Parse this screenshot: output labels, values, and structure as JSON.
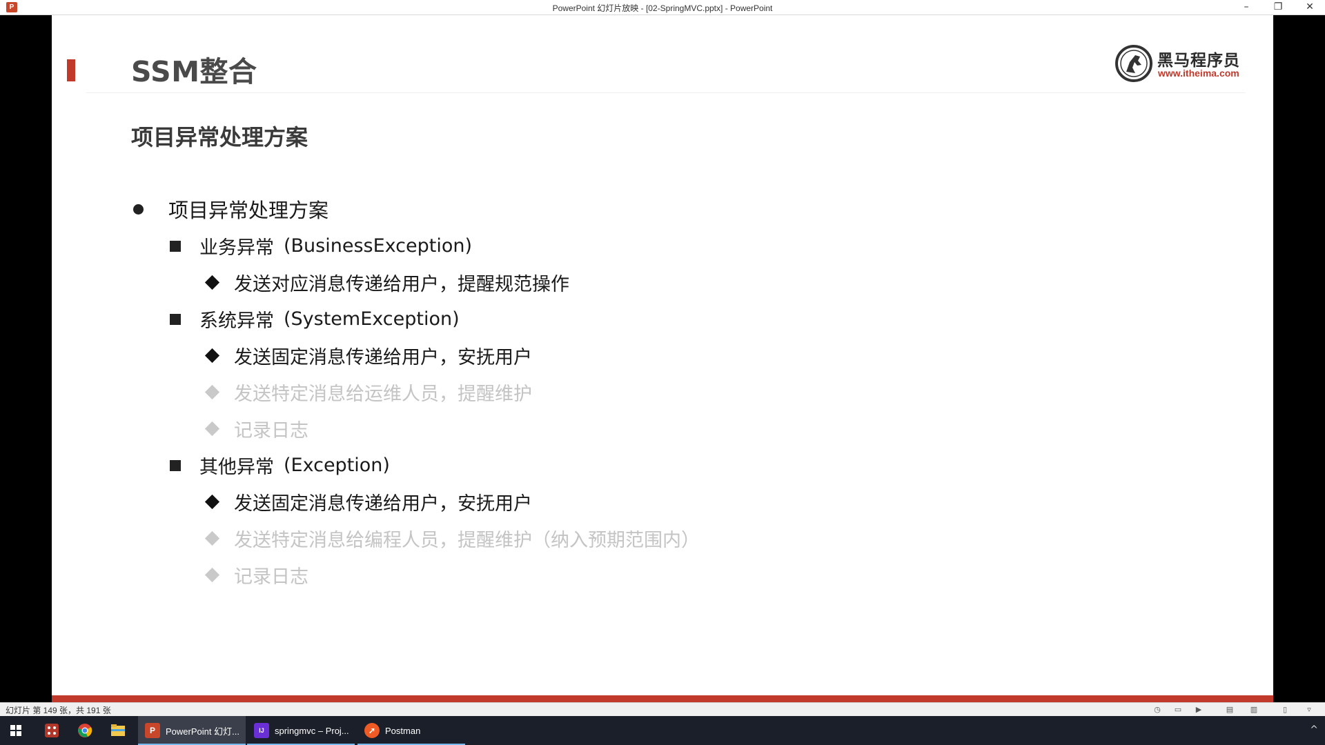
{
  "window": {
    "title": "PowerPoint 幻灯片放映 - [02-SpringMVC.pptx] - PowerPoint",
    "app_icon": "P",
    "minimize": "–",
    "restore": "❐",
    "close": "✕"
  },
  "slide": {
    "title": "SSM整合",
    "subtitle": "项目异常处理方案",
    "logo": {
      "brand": "黑马程序员",
      "url": "www.itheima.com"
    },
    "level1": {
      "text": "项目异常处理方案"
    },
    "groups": [
      {
        "label": "业务异常",
        "code": "(BusinessException)",
        "items": [
          {
            "text": "发送对应消息传递给用户，提醒规范操作",
            "faded": false
          }
        ]
      },
      {
        "label": "系统异常",
        "code": "(SystemException)",
        "items": [
          {
            "text": "发送固定消息传递给用户，安抚用户",
            "faded": false
          },
          {
            "text": "发送特定消息给运维人员，提醒维护",
            "faded": true
          },
          {
            "text": "记录日志",
            "faded": true
          }
        ]
      },
      {
        "label": "其他异常",
        "code": "(Exception)",
        "items": [
          {
            "text": "发送固定消息传递给用户，安抚用户",
            "faded": false
          },
          {
            "text": "发送特定消息给编程人员，提醒维护（纳入预期范围内）",
            "faded": true
          },
          {
            "text": "记录日志",
            "faded": true
          }
        ]
      }
    ],
    "colors": {
      "accent": "#c0392b",
      "faded_text": "#c4c4c4"
    }
  },
  "statusbar": {
    "slide_count": "幻灯片 第 149 张，共 191 张"
  },
  "taskbar": {
    "start_icon": "windows-start-icon",
    "pinned": [
      "app-grid-icon",
      "chrome-icon",
      "file-explorer-icon"
    ],
    "tasks": [
      {
        "label": "PowerPoint 幻灯...",
        "icon": "P",
        "color": "#c8472a",
        "active": true
      },
      {
        "label": "springmvc – Proj...",
        "icon": "IJ",
        "color": "#6b2fd6",
        "active": false
      },
      {
        "label": "Postman",
        "icon": "➚",
        "color": "#ef5b25",
        "active": false
      }
    ],
    "tray": "^"
  }
}
